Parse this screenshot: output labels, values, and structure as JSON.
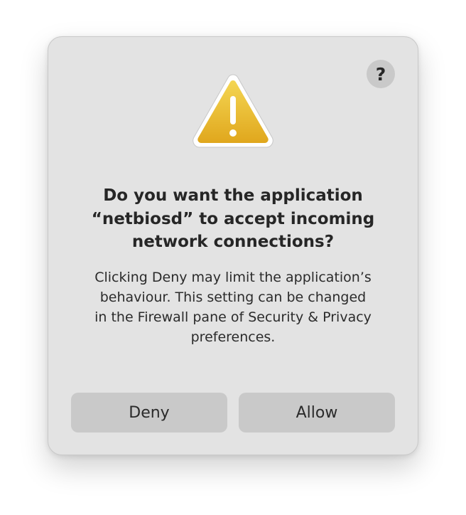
{
  "dialog": {
    "title": "Do you want the application\n“netbiosd” to accept incoming\nnetwork connections?",
    "message": "Clicking Deny may limit the application’s\nbehaviour. This setting can be changed\nin the Firewall pane of Security & Privacy\npreferences.",
    "help_label": "?",
    "icon": "warning-icon",
    "buttons": {
      "deny_label": "Deny",
      "allow_label": "Allow"
    }
  },
  "colors": {
    "dialog_background": "#e3e3e3",
    "button_background": "#c9c9c9",
    "warning_yellow_top": "#f3d24e",
    "warning_yellow_bottom": "#e2a91e",
    "text": "#262626"
  }
}
